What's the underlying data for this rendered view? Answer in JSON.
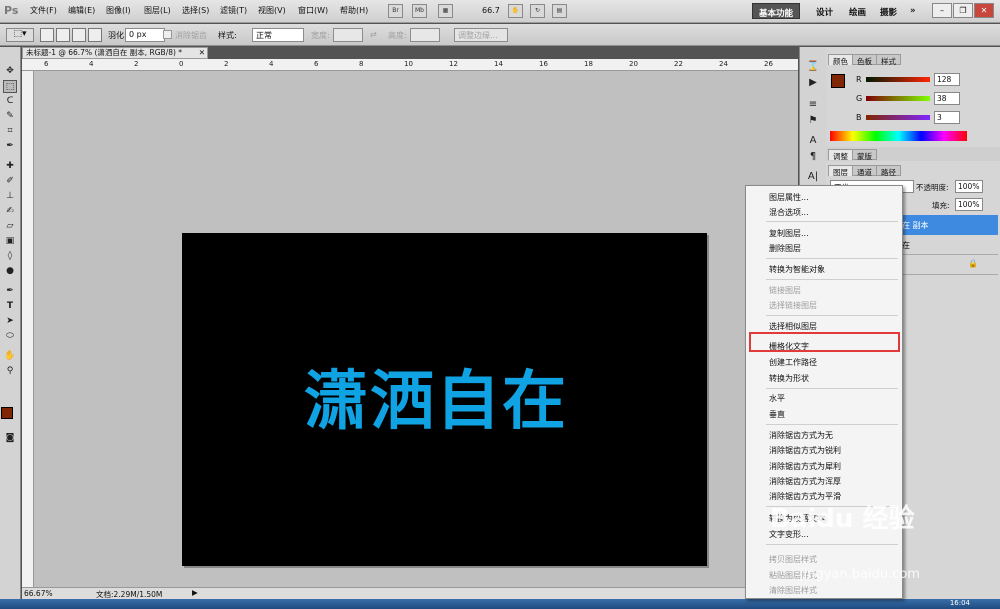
{
  "app": {
    "logo": "Ps"
  },
  "menubar": {
    "items": [
      "文件(F)",
      "编辑(E)",
      "图像(I)",
      "图层(L)",
      "选择(S)",
      "滤镜(T)",
      "视图(V)",
      "窗口(W)",
      "帮助(H)"
    ],
    "icons": [
      "Br",
      "Mb"
    ],
    "zoom": "66.7",
    "workspaces": [
      "基本功能",
      "设计",
      "绘画",
      "摄影"
    ],
    "more": "»"
  },
  "options": {
    "feather_label": "羽化:",
    "feather_value": "0 px",
    "antialias_label": "消除锯齿",
    "style_label": "样式:",
    "style_value": "正常",
    "width_label": "宽度:",
    "height_label": "高度:",
    "refine_label": "调整边缘..."
  },
  "document": {
    "tab_title": "未标题-1 @ 66.7% (潇洒自在 副本, RGB/8) *",
    "canvas_text": "潇洒自在",
    "canvas_text_color": "#10a3e3",
    "ruler_numbers": [
      "6",
      "4",
      "2",
      "0",
      "2",
      "4",
      "6",
      "8",
      "10",
      "12",
      "14",
      "16",
      "18",
      "20",
      "22",
      "24",
      "26"
    ],
    "zoom": "66.67%",
    "doc_info": "文档:2.29M/1.50M"
  },
  "color_panel": {
    "tabs": [
      "颜色",
      "色板",
      "样式"
    ],
    "r_label": "R",
    "r": "128",
    "g_label": "G",
    "g": "38",
    "b_label": "B",
    "b": "3",
    "fg_color": "#802603"
  },
  "adjust_panel": {
    "tabs": [
      "调整",
      "蒙版"
    ]
  },
  "layers_panel": {
    "tabs": [
      "图层",
      "通道",
      "路径"
    ],
    "blend_mode": "正常",
    "opacity_label": "不透明度:",
    "opacity": "100%",
    "fill_label": "填充:",
    "fill": "100%",
    "layer1": "在 副本",
    "layer2": "在"
  },
  "context_menu": {
    "items": [
      {
        "label": "图层属性...",
        "disabled": false
      },
      {
        "label": "混合选项...",
        "disabled": false
      },
      {
        "label": "复制图层...",
        "disabled": false
      },
      {
        "label": "删除图层",
        "disabled": false
      },
      {
        "label": "转换为智能对象",
        "disabled": false
      },
      {
        "label": "链接图层",
        "disabled": true
      },
      {
        "label": "选择链接图层",
        "disabled": true
      },
      {
        "label": "选择相似图层",
        "disabled": false
      },
      {
        "label": "栅格化文字",
        "disabled": false
      },
      {
        "label": "创建工作路径",
        "disabled": false
      },
      {
        "label": "转换为形状",
        "disabled": false
      },
      {
        "label": "水平",
        "disabled": false
      },
      {
        "label": "垂直",
        "disabled": false
      },
      {
        "label": "消除锯齿方式为无",
        "disabled": false
      },
      {
        "label": "消除锯齿方式为锐利",
        "disabled": false
      },
      {
        "label": "消除锯齿方式为犀利",
        "disabled": false
      },
      {
        "label": "消除锯齿方式为浑厚",
        "disabled": false
      },
      {
        "label": "消除锯齿方式为平滑",
        "disabled": false
      },
      {
        "label": "转换为段落文本",
        "disabled": false
      },
      {
        "label": "文字变形...",
        "disabled": false
      },
      {
        "label": "拷贝图层样式",
        "disabled": true
      },
      {
        "label": "粘贴图层样式",
        "disabled": true
      },
      {
        "label": "清除图层样式",
        "disabled": true
      }
    ],
    "highlight_color": "#e03a3a"
  },
  "watermark": {
    "text": "Baidu 经验",
    "url": "jingyan.baidu.com"
  },
  "taskbar": {
    "time": "16:04"
  }
}
